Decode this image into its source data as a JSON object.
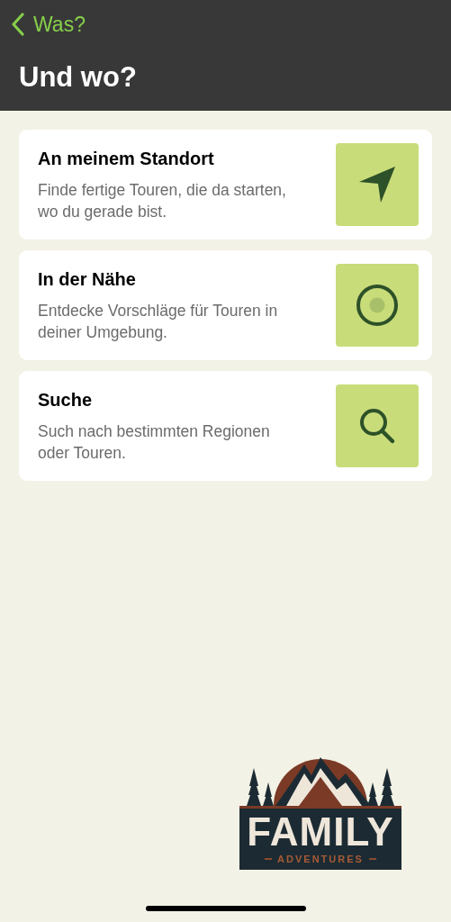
{
  "nav": {
    "back_label": "Was?",
    "title": "Und wo?"
  },
  "options": [
    {
      "kind": "location",
      "title": "An meinem Standort",
      "description": "Finde fertige Touren, die da starten, wo du gerade bist."
    },
    {
      "kind": "nearby",
      "title": "In der Nähe",
      "description": "Entdecke Vorschläge für Touren in deiner Umgebung."
    },
    {
      "kind": "search",
      "title": "Suche",
      "description": "Such nach bestimmten Regionen oder Touren."
    }
  ],
  "logo": {
    "title": "FAMILY",
    "subtitle": "ADVENTURES"
  }
}
